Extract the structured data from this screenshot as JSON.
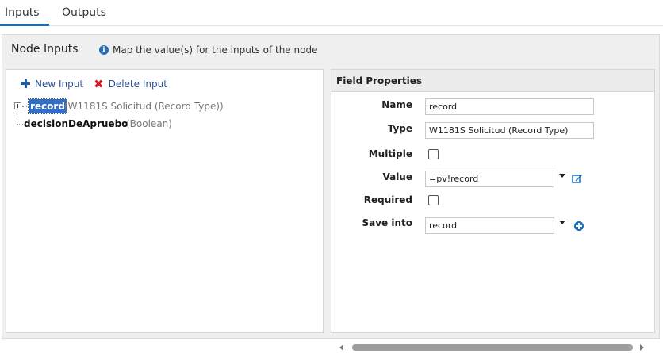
{
  "tabs": [
    {
      "label": "Inputs",
      "active": true
    },
    {
      "label": "Outputs",
      "active": false
    }
  ],
  "panel": {
    "title": "Node Inputs",
    "info_icon": "info-icon",
    "info_text": "Map the value(s) for the inputs of the node"
  },
  "toolbar": {
    "new_input_label": "New Input",
    "delete_input_label": "Delete Input"
  },
  "tree": {
    "nodes": [
      {
        "name": "record",
        "type": "(W1181S Solicitud (Record Type))",
        "selected": true,
        "expandable": true
      },
      {
        "name": "decisionDeApruebo",
        "type": "(Boolean)",
        "selected": false,
        "expandable": false
      }
    ]
  },
  "field_properties": {
    "title": "Field Properties",
    "name_label": "Name",
    "name_value": "record",
    "type_label": "Type",
    "type_value": "W1181S Solicitud (Record Type)",
    "multiple_label": "Multiple",
    "multiple_checked": false,
    "value_label": "Value",
    "value_value": "=pv!record",
    "required_label": "Required",
    "required_checked": false,
    "save_into_label": "Save into",
    "save_into_value": "record"
  },
  "colors": {
    "accent": "#1c6db5",
    "selection": "#2f6fc7",
    "delete": "#d11a2a",
    "panel_bg": "#efefef"
  }
}
